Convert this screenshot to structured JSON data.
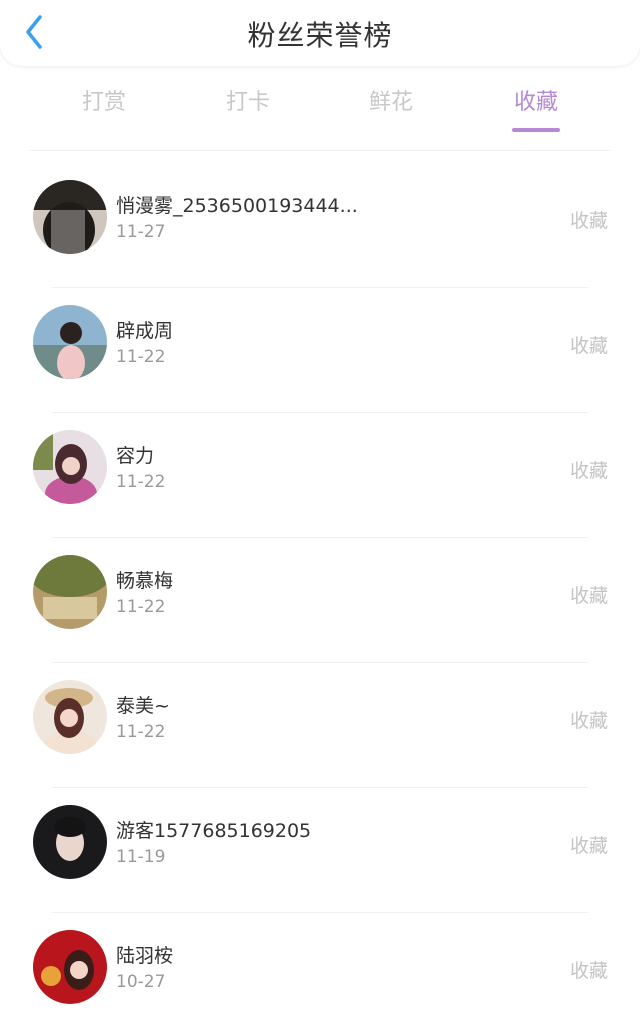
{
  "header": {
    "title": "粉丝荣誉榜",
    "back_icon": "chevron-left-icon",
    "accent": "#3a9ff0"
  },
  "tabs": [
    {
      "label": "打赏",
      "active": false
    },
    {
      "label": "打卡",
      "active": false
    },
    {
      "label": "鲜花",
      "active": false
    },
    {
      "label": "收藏",
      "active": true
    }
  ],
  "colors": {
    "active_tab": "#b48ad6",
    "inactive_tab": "#c8c8c8",
    "action_text": "#c4c4c4"
  },
  "fans": [
    {
      "name": "悄漫雾_2536500193444...",
      "date": "11-27",
      "action": "收藏"
    },
    {
      "name": "辟成周",
      "date": "11-22",
      "action": "收藏"
    },
    {
      "name": "容力",
      "date": "11-22",
      "action": "收藏"
    },
    {
      "name": "畅慕梅",
      "date": "11-22",
      "action": "收藏"
    },
    {
      "name": "泰美~",
      "date": "11-22",
      "action": "收藏"
    },
    {
      "name": "游客1577685169205",
      "date": "11-19",
      "action": "收藏"
    },
    {
      "name": "陆羽桉",
      "date": "10-27",
      "action": "收藏"
    }
  ]
}
